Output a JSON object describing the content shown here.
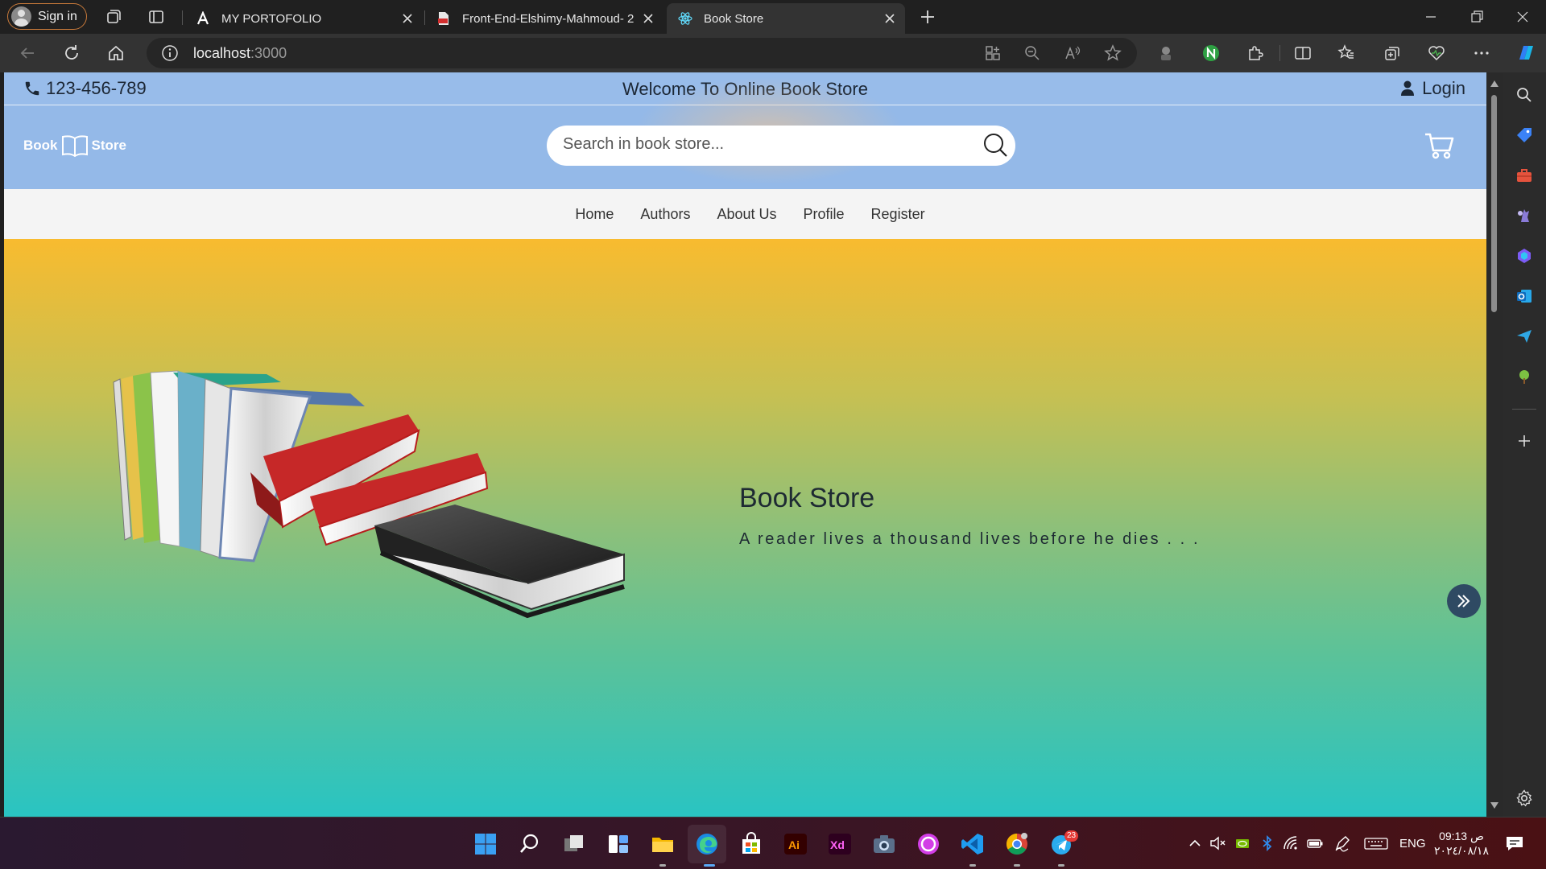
{
  "browser": {
    "profile_label": "Sign in",
    "tabs": [
      {
        "title": "MY PORTOFOLIO",
        "active": false
      },
      {
        "title": "Front-End-Elshimy-Mahmoud- 2",
        "active": false
      },
      {
        "title": "Book Store",
        "active": true
      }
    ],
    "address": {
      "host": "localhost",
      "port": ":3000"
    }
  },
  "topbar": {
    "phone": "123-456-789",
    "welcome": "Welcome To Online Book Store",
    "login": "Login"
  },
  "header": {
    "logo_left": "Book",
    "logo_right": "Store",
    "search_placeholder": "Search in book store..."
  },
  "nav": {
    "items": [
      "Home",
      "Authors",
      "About Us",
      "Profile",
      "Register"
    ]
  },
  "hero": {
    "title": "Book Store",
    "quote": "A reader lives a thousand lives before he dies . . ."
  },
  "taskbar": {
    "telegram_badge": "23",
    "lang": "ENG",
    "clock_time": "09:13 ص",
    "clock_date": "٢٠٢٤/٠٨/١٨"
  },
  "colors": {
    "topbar_bg": "#98bcea",
    "header_bg": "#94b9e8",
    "nav_bg": "#f4f4f4",
    "hero_gradient_top": "#f8bb2f",
    "hero_gradient_bottom": "#29c4c2",
    "hero_next_button": "#2f4a63"
  },
  "icons": {
    "phone": "phone-icon",
    "login": "user-icon",
    "logo": "open-book-icon",
    "search": "search-icon",
    "cart": "cart-icon",
    "hero_next": "double-chevron-right-icon"
  }
}
